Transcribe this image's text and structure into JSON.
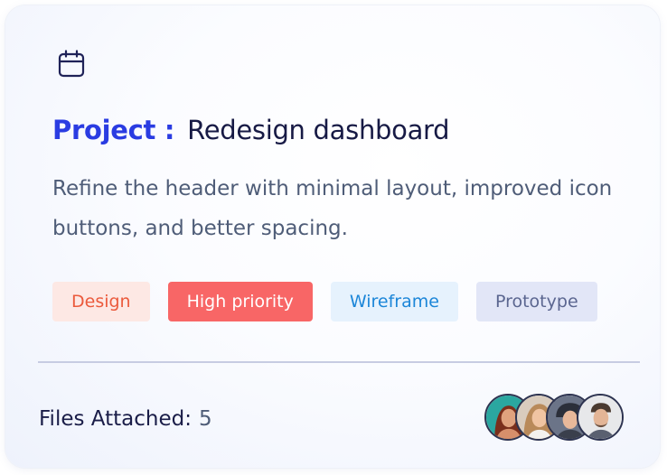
{
  "card": {
    "icon": "calendar-icon",
    "title_label": "Project :",
    "title_value": "Redesign dashboard",
    "description": "Refine the header with minimal layout, improved icon buttons, and better spacing.",
    "tags": [
      {
        "label": "Design",
        "color": "#eb5a3c",
        "background": "#fde8e4"
      },
      {
        "label": "High priority",
        "color": "#ffffff",
        "background": "#f86666"
      },
      {
        "label": "Wireframe",
        "color": "#1c86d8",
        "background": "#e6f2fd"
      },
      {
        "label": "Prototype",
        "color": "#5b6690",
        "background": "#e2e6f7"
      }
    ],
    "files_label": "Files Attached:",
    "files_count": "5",
    "avatars": [
      "avatar-1",
      "avatar-2",
      "avatar-3",
      "avatar-4"
    ]
  },
  "colors": {
    "accent": "#2a3ce2",
    "heading": "#171a45",
    "body_text": "#4f5d78",
    "divider": "#c7cce2"
  }
}
